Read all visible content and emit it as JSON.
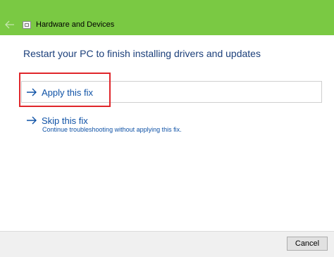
{
  "window": {
    "title": "Hardware and Devices",
    "back_icon": "back-arrow-icon",
    "app_icon": "troubleshooter-icon"
  },
  "main": {
    "heading": "Restart your PC to finish installing drivers and updates",
    "apply": {
      "label": "Apply this fix",
      "icon": "arrow-right-icon"
    },
    "skip": {
      "label": "Skip this fix",
      "description": "Continue troubleshooting without applying this fix.",
      "icon": "arrow-right-icon"
    }
  },
  "footer": {
    "cancel_label": "Cancel"
  },
  "colors": {
    "titlebar": "#7ac943",
    "link": "#0f52a6",
    "highlight": "#e0262b"
  }
}
